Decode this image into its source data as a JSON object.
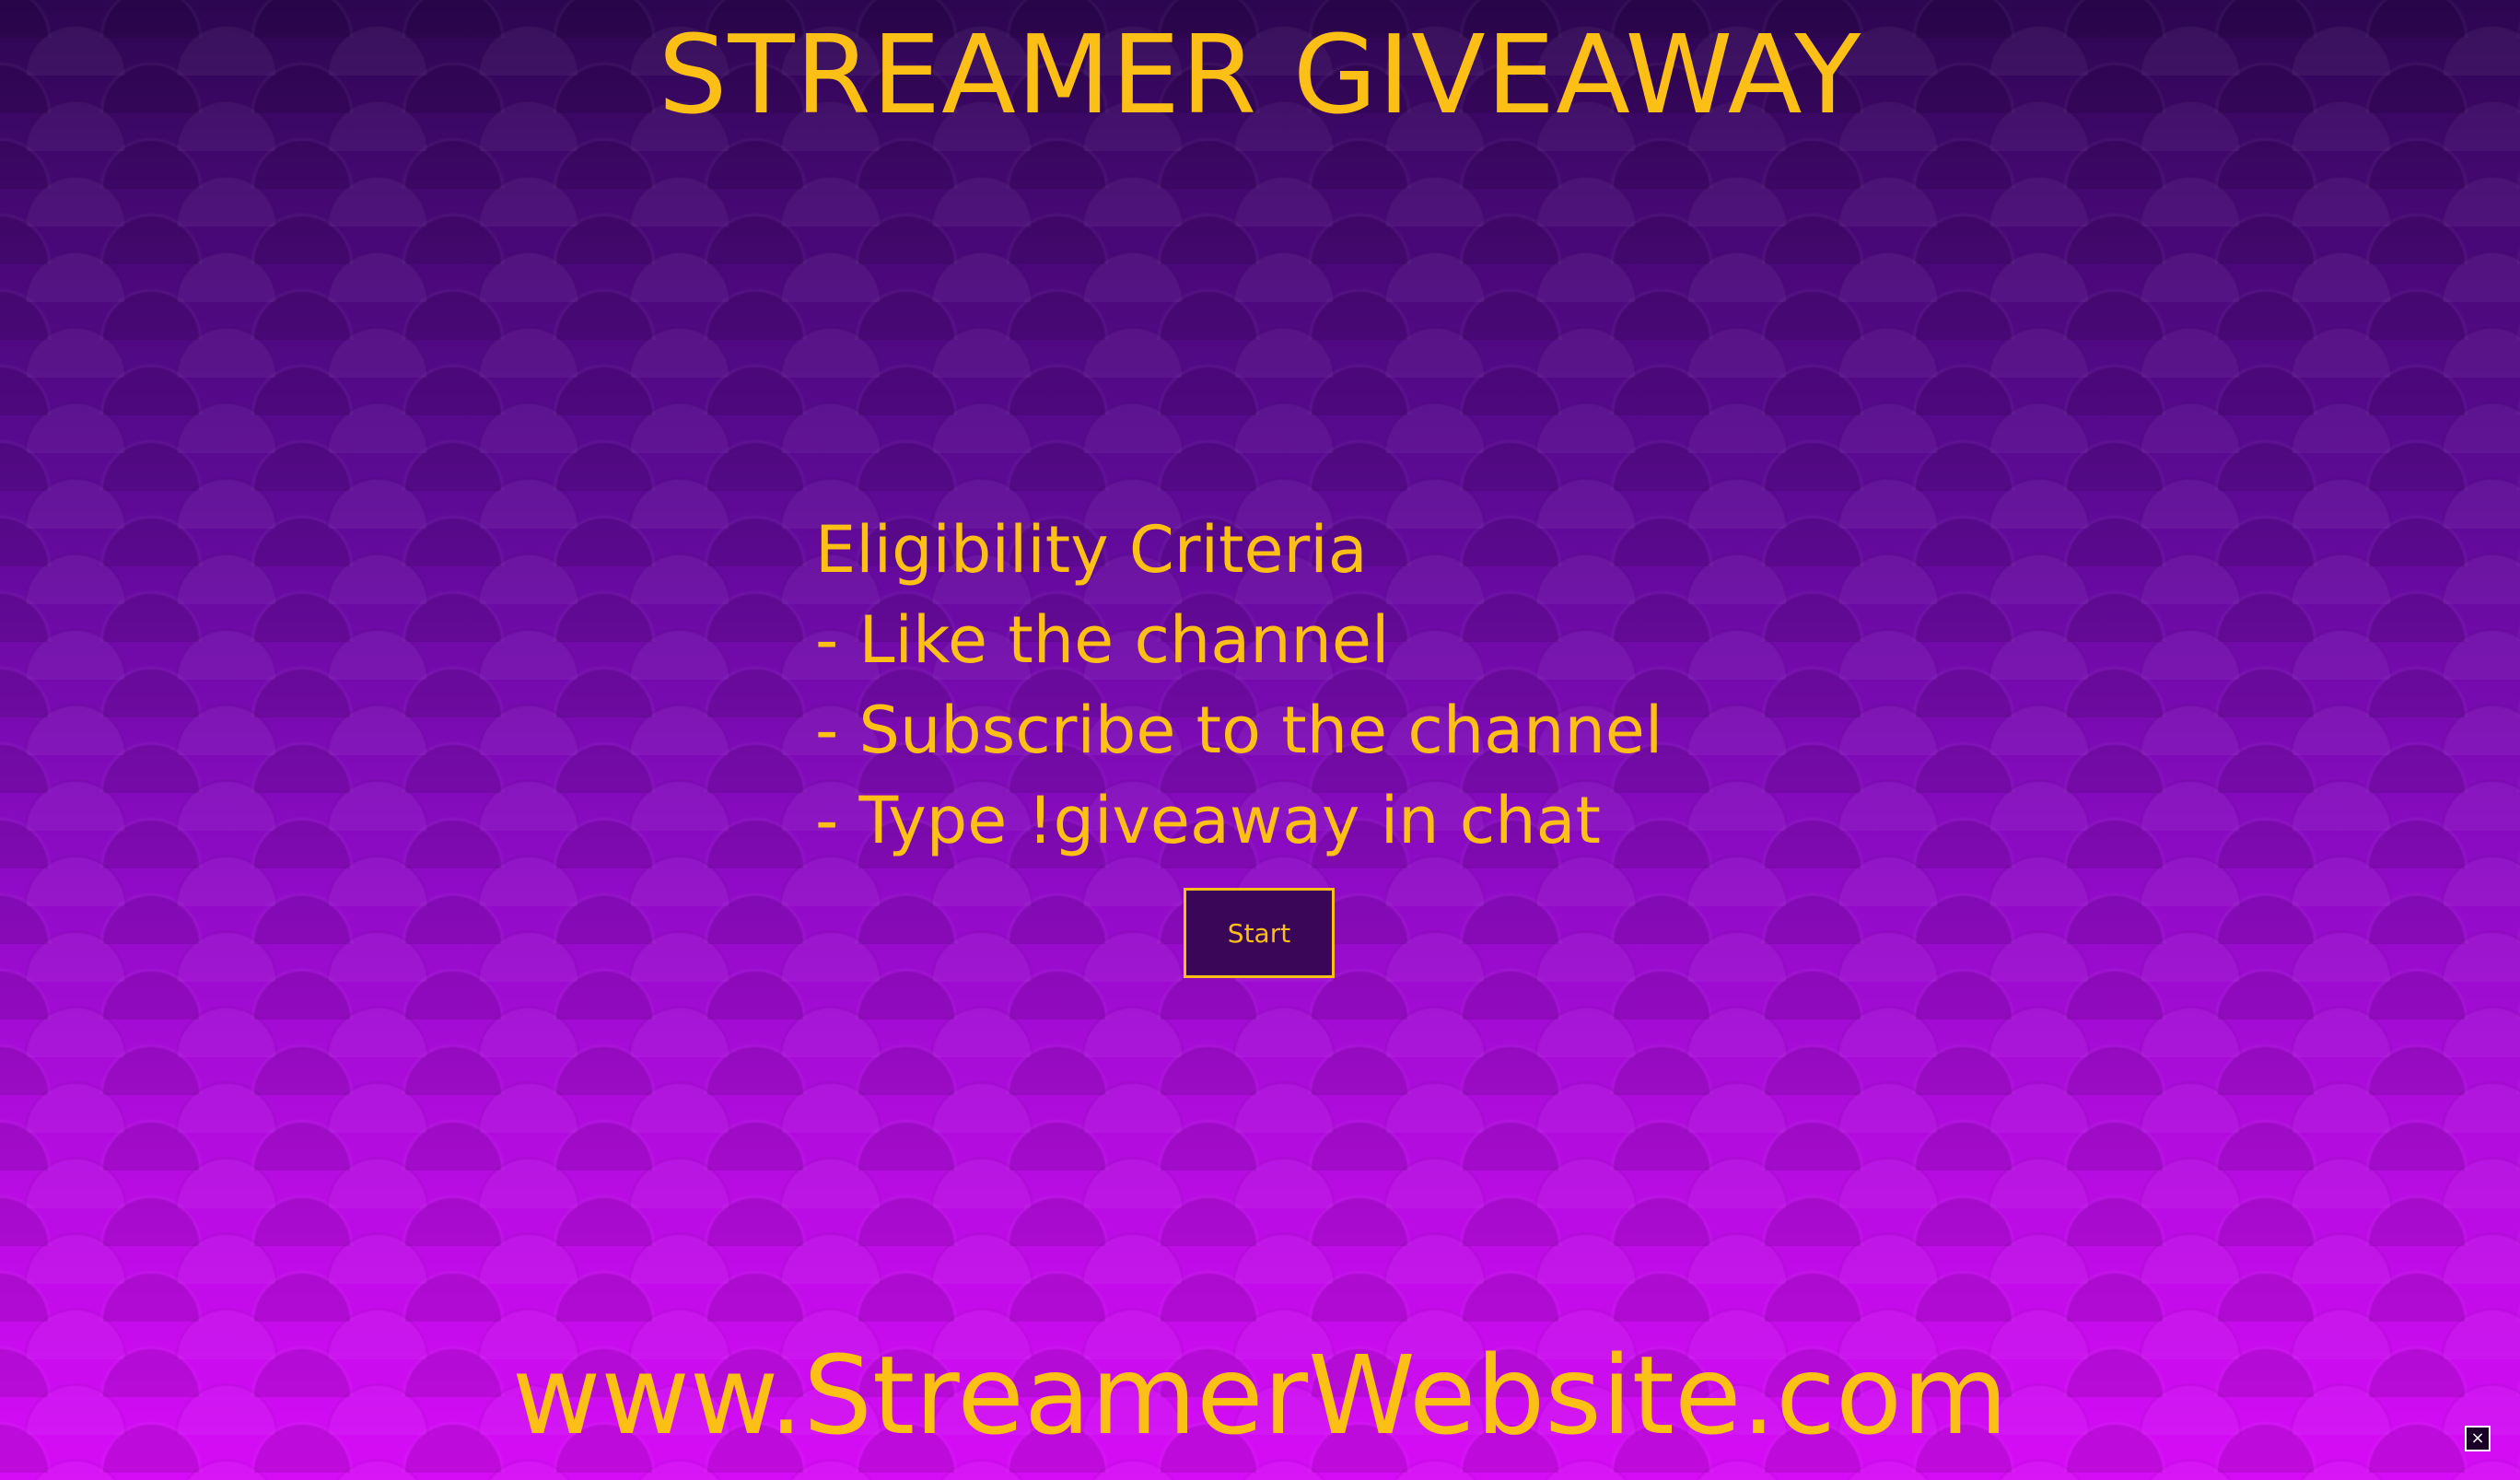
{
  "header": {
    "title": "STREAMER GIVEAWAY"
  },
  "eligibility": {
    "heading": "Eligibility Criteria",
    "items": [
      "- Like the channel",
      "- Subscribe to the channel",
      "- Type !giveaway in chat"
    ]
  },
  "actions": {
    "start_label": "Start"
  },
  "footer": {
    "website": "www.StreamerWebsite.com"
  },
  "overlay": {
    "close_glyph": "×",
    "close_icon": "close-icon"
  },
  "colors": {
    "accent": "#fbbf16",
    "background_top": "#2c0650",
    "background_bottom": "#d60cf6",
    "button_fill": "#3a0657"
  }
}
